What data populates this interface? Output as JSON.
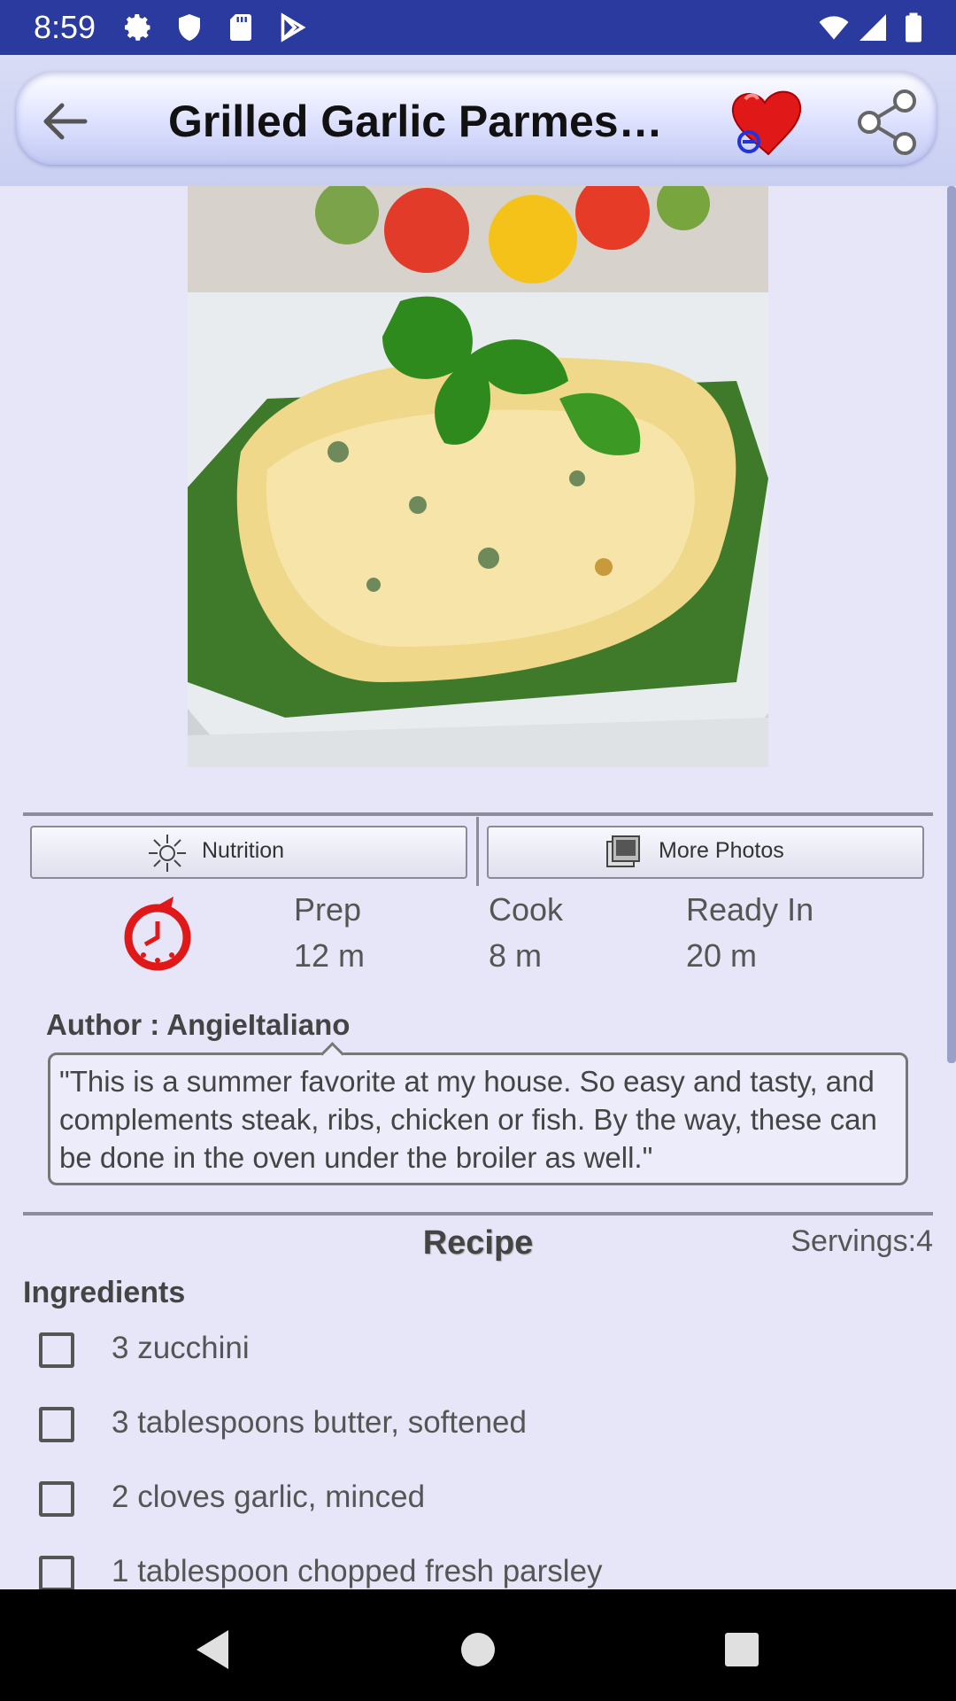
{
  "status_bar": {
    "time": "8:59"
  },
  "toolbar": {
    "title": "Grilled Garlic Parmesan Zucchini"
  },
  "buttons": {
    "nutrition": "Nutrition",
    "more_photos": "More Photos"
  },
  "times": {
    "prep_label": "Prep",
    "prep_value": "12 m",
    "cook_label": "Cook",
    "cook_value": "8 m",
    "ready_label": "Ready In",
    "ready_value": "20 m"
  },
  "author": "Author : AngieItaliano",
  "description": "\"This is a summer favorite at my house. So easy and tasty, and complements steak, ribs, chicken or fish. By the way, these can be done in the oven under the broiler as well.\"",
  "recipe": {
    "heading": "Recipe",
    "servings": "Servings:4",
    "ingredients_heading": "Ingredients",
    "ingredients": [
      "3 zucchini",
      "3 tablespoons butter, softened",
      "2 cloves garlic, minced",
      "1 tablespoon chopped fresh parsley"
    ]
  },
  "colors": {
    "status_bar": "#2a3a9e",
    "background": "#e6e6f8",
    "heart": "#e01818"
  }
}
